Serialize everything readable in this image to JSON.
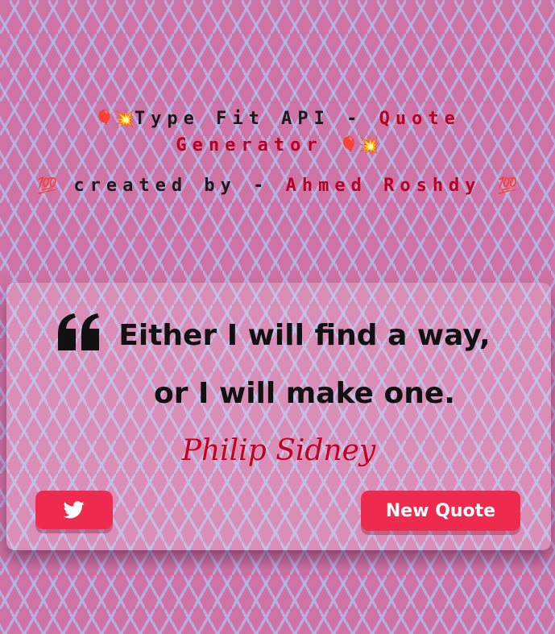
{
  "header": {
    "title_emoji_start": "🎈💥",
    "title_prefix": "Type Fit API - ",
    "title_highlight": "Quote Generator",
    "title_emoji_end": "🎈💥",
    "credit_emoji_start": "💯",
    "credit_prefix": "created by - ",
    "credit_highlight": "Ahmed Roshdy",
    "credit_emoji_end": "💯"
  },
  "quote": {
    "icon": "quote-left-icon",
    "text": "Either I will find a way, or I will make one.",
    "author": "Philip Sidney"
  },
  "buttons": {
    "tweet_icon": "twitter-icon",
    "new_quote_label": "New Quote"
  },
  "colors": {
    "background": "#cf72a6",
    "accent_text": "#b8001f",
    "author_text": "#c4001f",
    "button": "#ef2a4f"
  }
}
